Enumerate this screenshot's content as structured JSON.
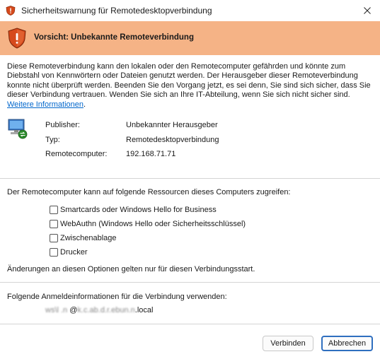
{
  "window": {
    "title": "Sicherheitswarnung für Remotedesktopverbindung"
  },
  "banner": {
    "text": "Vorsicht: Unbekannte Remoteverbindung"
  },
  "description": {
    "lines": [
      "Diese Remoteverbindung kann den lokalen oder den Remotecomputer gefährden und könnte zum",
      "Diebstahl von Kennwörtern oder Dateien genutzt werden. Der Herausgeber dieser Remoteverbindung",
      "konnte nicht überprüft werden. Beenden Sie den Vorgang jetzt, es sei denn, Sie sind sich sicher, dass Sie",
      "dieser Verbindung vertrauen. Wenden Sie sich an Ihre IT-Abteilung, wenn Sie sich nicht sicher sind."
    ],
    "link": "Weitere Informationen",
    "link_suffix": "."
  },
  "info": {
    "publisher_label": "Publisher:",
    "publisher_value": "Unbekannter Herausgeber",
    "type_label": "Typ:",
    "type_value": "Remotedesktopverbindung",
    "remote_label": "Remotecomputer:",
    "remote_value": "192.168.71.71"
  },
  "resources": {
    "intro": "Der Remotecomputer kann auf folgende Ressourcen dieses Computers zugreifen:",
    "items": [
      {
        "label": "Smartcards oder Windows Hello for Business",
        "checked": false
      },
      {
        "label": "WebAuthn (Windows Hello oder Sicherheitsschlüssel)",
        "checked": false
      },
      {
        "label": "Zwischenablage",
        "checked": false
      },
      {
        "label": "Drucker",
        "checked": false
      }
    ],
    "note": "Änderungen an diesen Optionen gelten nur für diesen Verbindungsstart."
  },
  "credentials": {
    "label": "Folgende Anmeldeinformationen für die Verbindung verwenden:",
    "user_blurred_1": "ws\\l .n",
    "user_at": "@",
    "user_blurred_2": "k.c.ab.d.r.ebun.n",
    "user_tail": ".local"
  },
  "buttons": {
    "connect": "Verbinden",
    "cancel": "Abbrechen"
  },
  "colors": {
    "banner": "#f5b386",
    "link": "#0066cc",
    "shield": "#d64a1c"
  }
}
